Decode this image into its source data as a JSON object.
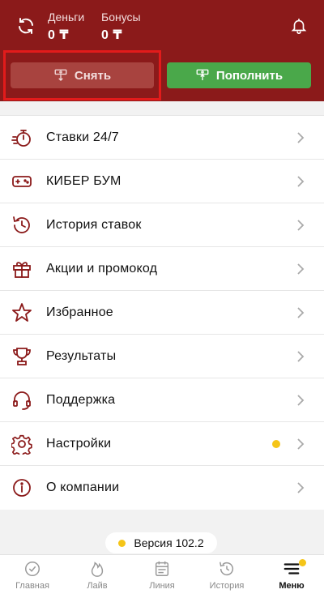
{
  "header": {
    "money_label": "Деньги",
    "money_value": "0 ₸",
    "bonus_label": "Бонусы",
    "bonus_value": "0 ₸",
    "withdraw_label": "Снять",
    "deposit_label": "Пополнить"
  },
  "menu": {
    "items": [
      {
        "label": "Ставки 24/7",
        "icon": "stopwatch-icon"
      },
      {
        "label": "КИБЕР БУМ",
        "icon": "gamepad-icon"
      },
      {
        "label": "История ставок",
        "icon": "history-icon"
      },
      {
        "label": "Акции и промокод",
        "icon": "gift-icon"
      },
      {
        "label": "Избранное",
        "icon": "star-icon"
      },
      {
        "label": "Результаты",
        "icon": "trophy-icon"
      },
      {
        "label": "Поддержка",
        "icon": "headset-icon"
      },
      {
        "label": "Настройки",
        "icon": "gear-icon"
      },
      {
        "label": "О компании",
        "icon": "info-icon"
      }
    ]
  },
  "version": "Версия 102.2",
  "tabbar": {
    "tabs": [
      {
        "label": "Главная",
        "icon": "home-badge-icon"
      },
      {
        "label": "Лайв",
        "icon": "flame-icon"
      },
      {
        "label": "Линия",
        "icon": "calendar-icon"
      },
      {
        "label": "История",
        "icon": "history-icon"
      },
      {
        "label": "Меню",
        "icon": "hamburger-icon"
      }
    ]
  },
  "colors": {
    "brand": "#8b1a1a",
    "withdraw": "#a8433f",
    "deposit": "#4aa84a",
    "accent_dot": "#f5c518",
    "highlight": "#e21b1b"
  }
}
